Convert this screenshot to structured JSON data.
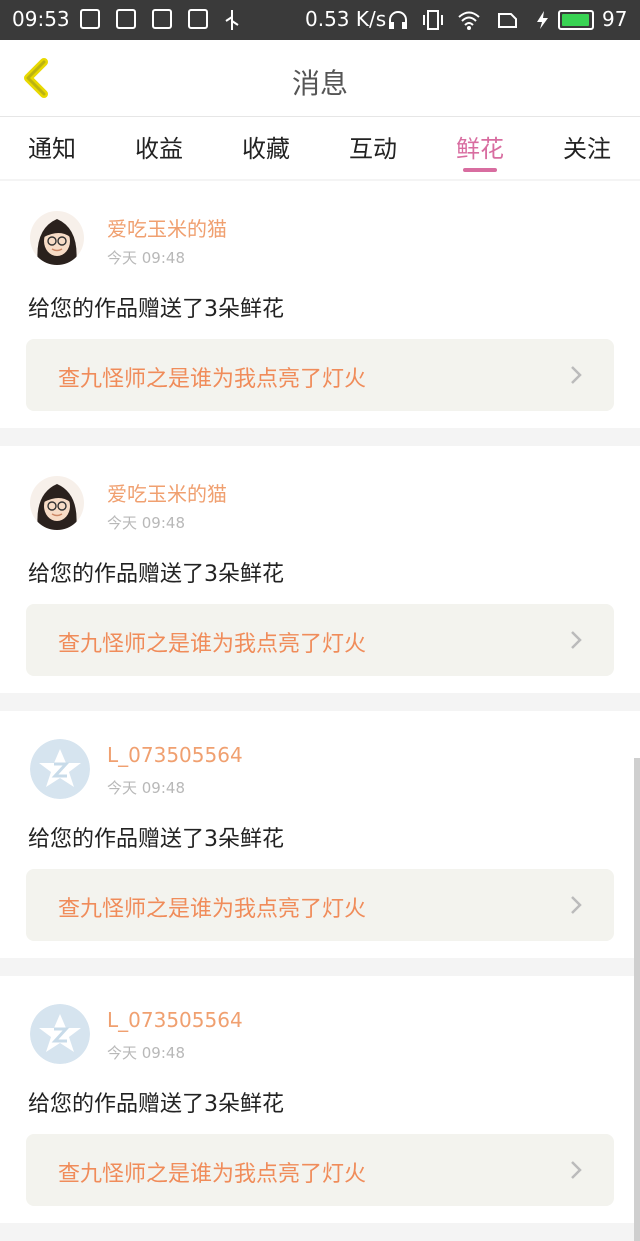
{
  "status_bar": {
    "time": "09:53",
    "net_speed": "0.53 K/s",
    "battery": "97",
    "battery_level": 0.97
  },
  "header": {
    "title": "消息"
  },
  "tabs": [
    {
      "label": "通知"
    },
    {
      "label": "收益"
    },
    {
      "label": "收藏"
    },
    {
      "label": "互动"
    },
    {
      "label": "鲜花",
      "active": true
    },
    {
      "label": "关注"
    }
  ],
  "messages": [
    {
      "username": "爱吃玉米的猫",
      "time": "今天 09:48",
      "text": "给您的作品赠送了3朵鲜花",
      "link": "查九怪师之是谁为我点亮了灯火",
      "avatar": "girl-avatar"
    },
    {
      "username": "爱吃玉米的猫",
      "time": "今天 09:48",
      "text": "给您的作品赠送了3朵鲜花",
      "link": "查九怪师之是谁为我点亮了灯火",
      "avatar": "girl-avatar"
    },
    {
      "username": "L_073505564",
      "time": "今天 09:48",
      "text": "给您的作品赠送了3朵鲜花",
      "link": "查九怪师之是谁为我点亮了灯火",
      "avatar": "default-avatar"
    },
    {
      "username": "L_073505564",
      "time": "今天 09:48",
      "text": "给您的作品赠送了3朵鲜花",
      "link": "查九怪师之是谁为我点亮了灯火",
      "avatar": "default-avatar"
    }
  ],
  "colors": {
    "accent_pink": "#d86da0",
    "username_orange": "#f0a070",
    "link_orange": "#f08c5a"
  }
}
